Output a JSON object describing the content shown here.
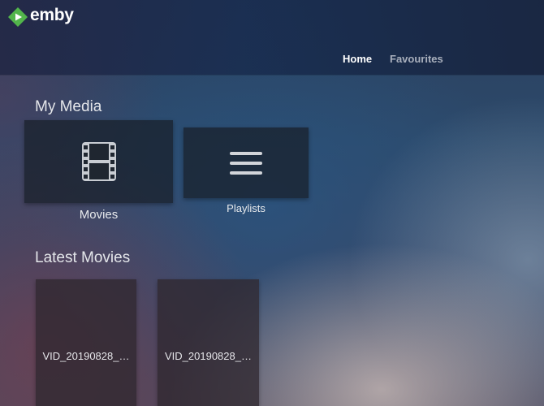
{
  "app": {
    "name": "emby"
  },
  "nav": {
    "tabs": [
      {
        "label": "Home",
        "active": true
      },
      {
        "label": "Favourites",
        "active": false
      }
    ]
  },
  "my_media": {
    "title": "My Media",
    "items": [
      {
        "label": "Movies",
        "icon": "film-icon"
      },
      {
        "label": "Playlists",
        "icon": "list-icon"
      }
    ]
  },
  "latest_movies": {
    "title": "Latest Movies",
    "items": [
      {
        "title": "VID_20190828_…"
      },
      {
        "title": "VID_20190828_…"
      }
    ]
  },
  "colors": {
    "logo_green": "#52b54b",
    "text_primary": "#ffffff",
    "text_muted": "#a9b0bd"
  }
}
